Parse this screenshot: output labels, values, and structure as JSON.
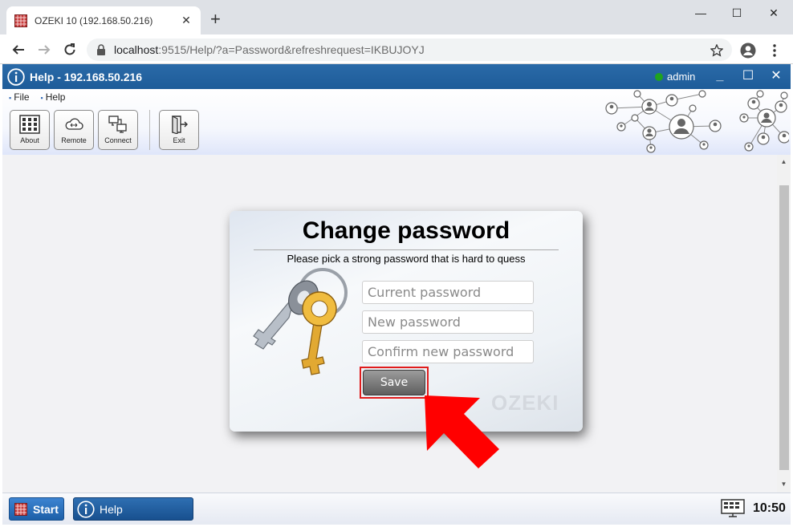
{
  "browser": {
    "tab_title": "OZEKI 10 (192.168.50.216)",
    "url_host": "localhost",
    "url_path": ":9515/Help/?a=Password&refreshrequest=IKBUJOYJ",
    "controls": {
      "close_tab": "✕",
      "new_tab": "+",
      "minimize": "—",
      "maximize": "☐",
      "close": "✕"
    }
  },
  "app_header": {
    "title": "Help - 192.168.50.216",
    "user": "admin",
    "status_color": "#1fa31f",
    "controls": {
      "minimize": "_",
      "maximize": "☐",
      "close": "✕"
    }
  },
  "menu": [
    {
      "label": "File"
    },
    {
      "label": "Help"
    }
  ],
  "toolbar": [
    {
      "label": "About",
      "icon": "grid-icon"
    },
    {
      "label": "Remote",
      "icon": "cloud-arrows-icon"
    },
    {
      "label": "Connect",
      "icon": "monitors-icon"
    },
    {
      "label": "Exit",
      "icon": "exit-door-icon"
    }
  ],
  "dialog": {
    "title": "Change password",
    "subtitle": "Please pick a strong password that is hard to quess",
    "fields": [
      {
        "placeholder": "Current password",
        "value": ""
      },
      {
        "placeholder": "New password",
        "value": ""
      },
      {
        "placeholder": "Confirm new password",
        "value": ""
      }
    ],
    "save_label": "Save",
    "watermark": "OZEKI",
    "highlight_color": "#e01c1c"
  },
  "taskbar": {
    "start_label": "Start",
    "task_label": "Help",
    "clock": "10:50"
  },
  "colors": {
    "header_blue": "#1e5c99",
    "arrow_red": "#ff0000"
  }
}
